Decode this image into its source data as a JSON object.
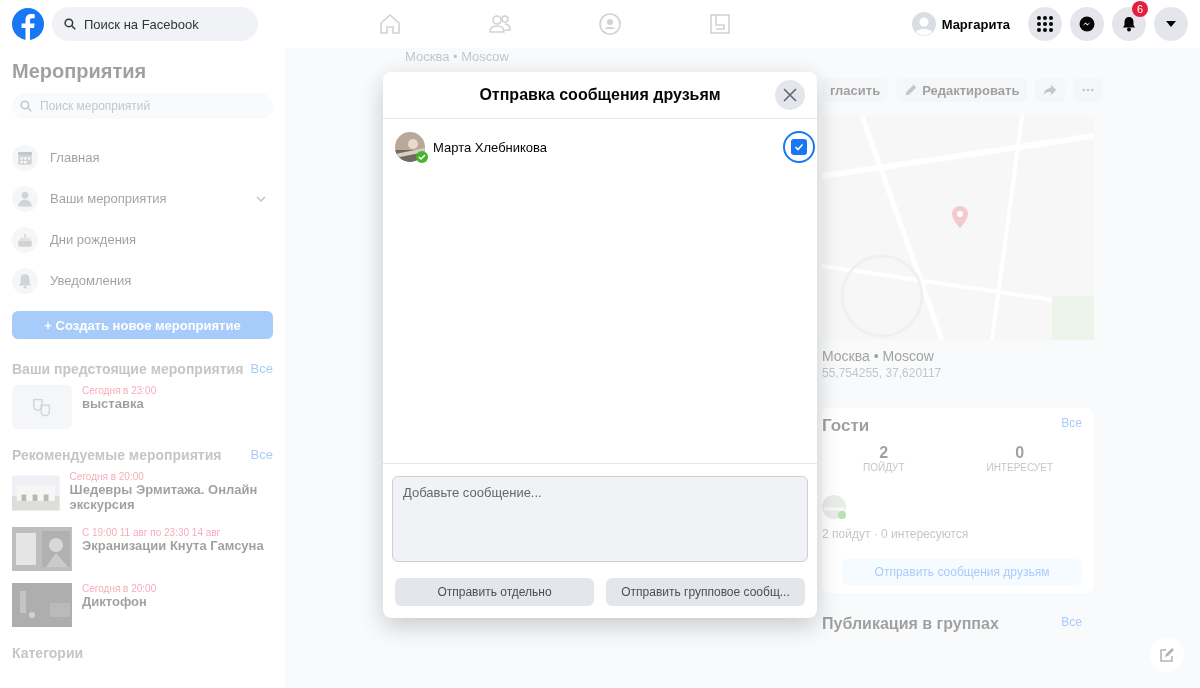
{
  "header": {
    "search": {
      "placeholder": "Поиск на Facebook"
    },
    "user": {
      "name": "Маргарита"
    },
    "notifications_badge": "6"
  },
  "sidebar": {
    "title": "Мероприятия",
    "search": {
      "placeholder": "Поиск мероприятий"
    },
    "items": [
      {
        "label": "Главная",
        "expandable": false
      },
      {
        "label": "Ваши мероприятия",
        "expandable": true
      },
      {
        "label": "Дни рождения",
        "expandable": false
      },
      {
        "label": "Уведомления",
        "expandable": false
      }
    ],
    "create_button": "+ Создать новое мероприятие",
    "sections": [
      {
        "title": "Ваши предстоящие мероприятия",
        "link": "Все",
        "events": [
          {
            "time": "Сегодня в 23:00",
            "title": "выставка",
            "kind": "icon"
          }
        ]
      },
      {
        "title": "Рекомендуемые мероприятия",
        "link": "Все",
        "events": [
          {
            "time": "Сегодня в 20:00",
            "title": "Шедевры Эрмитажа. Онлайн экскурсия",
            "kind": "picture"
          },
          {
            "time": "С 19:00 11 авг по 23:30 14 авг",
            "title": "Экранизации Кнута Гамсуна",
            "kind": "picture"
          },
          {
            "time": "Сегодня в 20:00",
            "title": "Диктофон",
            "kind": "picture"
          }
        ]
      },
      {
        "title": "Категории"
      }
    ]
  },
  "event": {
    "location_header": "Москва • Moscow",
    "actions": [
      "гласить",
      "Редактировать"
    ],
    "location": {
      "name": "Москва • Moscow",
      "coords": "55,754255, 37,620117"
    },
    "guests": {
      "title": "Гости",
      "link": "Все",
      "stats": [
        {
          "value": "2",
          "label": "ПОЙДУТ"
        },
        {
          "value": "0",
          "label": "ИНТЕРЕСУЕТ"
        }
      ],
      "summary": "2 пойдут · 0 интересуются",
      "button": "Отправить сообщения друзьям"
    },
    "groups": {
      "title": "Публикация в группах",
      "link": "Все"
    }
  },
  "dialog": {
    "title": "Отправка сообщения друзьям",
    "friends": [
      {
        "name": "Марта Хлебникова",
        "online": true,
        "checked": true
      }
    ],
    "message": {
      "placeholder": "Добавьте сообщение..."
    },
    "buttons": [
      {
        "label": "Отправить отдельно",
        "disabled": true
      },
      {
        "label": "Отправить групповое сообщ...",
        "disabled": true
      }
    ]
  }
}
